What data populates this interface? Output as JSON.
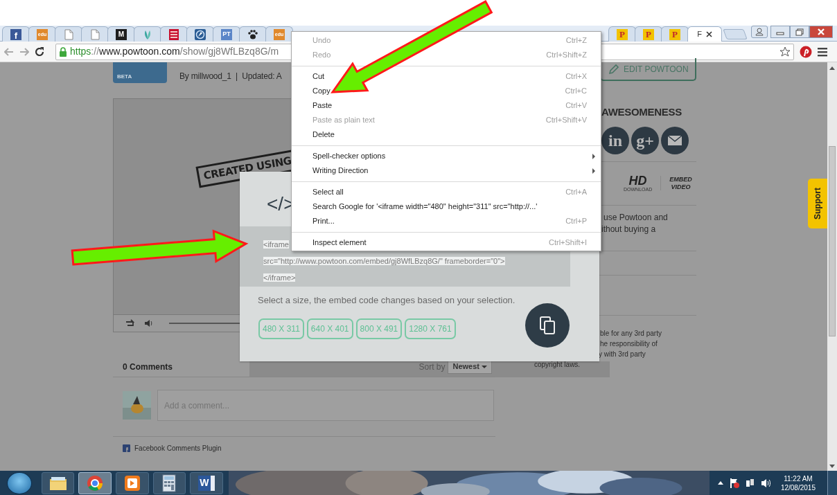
{
  "browser": {
    "tabs": [
      {
        "kind": "facebook",
        "icon_text": "f",
        "selected": false
      },
      {
        "kind": "edu",
        "icon_text": "edu",
        "selected": false
      },
      {
        "kind": "page",
        "selected": false
      },
      {
        "kind": "page",
        "selected": false
      },
      {
        "kind": "letter",
        "icon_text": "M",
        "selected": false
      },
      {
        "kind": "leaf",
        "selected": false
      },
      {
        "kind": "poster",
        "selected": false
      },
      {
        "kind": "compass",
        "selected": false
      },
      {
        "kind": "letter_blue",
        "icon_text": "PT",
        "selected": false
      },
      {
        "kind": "paw",
        "selected": false
      },
      {
        "kind": "edu",
        "icon_text": "edu",
        "selected": false
      }
    ],
    "more_tabs": [
      {
        "kind": "powtoon",
        "icon_text": "P",
        "selected": false
      },
      {
        "kind": "powtoon",
        "icon_text": "P",
        "selected": false
      },
      {
        "kind": "powtoon",
        "icon_text": "P",
        "selected": false
      },
      {
        "kind": "plain",
        "label": "F",
        "selected": true
      }
    ],
    "address": {
      "secure": true,
      "scheme": "https",
      "separator": "://",
      "host": "www.powtoon.com",
      "path": "/show/gj8WfLBzq8G/m"
    }
  },
  "page": {
    "logo_badge": "BETA",
    "byline": "By millwood_1  |  Updated: A",
    "video": {
      "stamp": "CREATED USING"
    },
    "comments": {
      "count": "0 Comments",
      "sort_label": "Sort by",
      "sort_value": "Newest",
      "placeholder": "Add a comment...",
      "plugin": "Facebook Comments Plugin"
    },
    "edit_button": "EDIT POWTOON",
    "share_heading": "AWESOMENESS",
    "share_buttons": [
      {
        "kind": "text",
        "label": "in"
      },
      {
        "kind": "text",
        "label": "g+"
      },
      {
        "kind": "mail"
      }
    ],
    "features": [
      {
        "title": "HD",
        "subtitle": "DOWNLOAD"
      },
      {
        "title": "EMBED VIDEO"
      }
    ],
    "promo_lines": [
      "use Powtoon and",
      "ithout buying a"
    ],
    "disclaimer_lines": [
      "ble for any 3rd party",
      "he responsibility of",
      "y with 3rd party",
      "copyright laws."
    ],
    "support_tab": "Support"
  },
  "embed_dialog": {
    "code_symbol": "</>",
    "code_lines": [
      "<iframe",
      "src=\"http://www.powtoon.com/embed/gj8WfLBzq8G/\" frameborder=\"0\">",
      "</iframe>"
    ],
    "hint": "Select a size, the embed code changes based on your selection.",
    "sizes": [
      "480 X 311",
      "640 X 401",
      "800 X 491",
      "1280 X 761"
    ]
  },
  "context_menu": [
    {
      "kind": "item",
      "label": "Undo",
      "shortcut": "Ctrl+Z",
      "disabled": true
    },
    {
      "kind": "item",
      "label": "Redo",
      "shortcut": "Ctrl+Shift+Z",
      "disabled": true
    },
    {
      "kind": "separator"
    },
    {
      "kind": "item",
      "label": "Cut",
      "shortcut": "Ctrl+X",
      "disabled": false
    },
    {
      "kind": "item",
      "label": "Copy",
      "shortcut": "Ctrl+C",
      "disabled": false
    },
    {
      "kind": "item",
      "label": "Paste",
      "shortcut": "Ctrl+V",
      "disabled": false
    },
    {
      "kind": "item",
      "label": "Paste as plain text",
      "shortcut": "Ctrl+Shift+V",
      "disabled": true
    },
    {
      "kind": "item",
      "label": "Delete",
      "disabled": false
    },
    {
      "kind": "separator"
    },
    {
      "kind": "item",
      "label": "Spell-checker options",
      "submenu": true,
      "disabled": false
    },
    {
      "kind": "item",
      "label": "Writing Direction",
      "submenu": true,
      "disabled": false
    },
    {
      "kind": "separator"
    },
    {
      "kind": "item",
      "label": "Select all",
      "shortcut": "Ctrl+A",
      "disabled": false
    },
    {
      "kind": "item",
      "label": "Search Google for '<iframe width=\"480\" height=\"311\" src=\"http://...'",
      "disabled": false
    },
    {
      "kind": "item",
      "label": "Print...",
      "shortcut": "Ctrl+P",
      "disabled": false
    },
    {
      "kind": "separator"
    },
    {
      "kind": "item",
      "label": "Inspect element",
      "shortcut": "Ctrl+Shift+I",
      "disabled": false
    }
  ],
  "taskbar": {
    "apps": [
      {
        "kind": "explorer",
        "selected": false
      },
      {
        "kind": "chrome",
        "selected": true
      },
      {
        "kind": "media",
        "selected": false
      },
      {
        "kind": "calculator",
        "selected": false
      },
      {
        "kind": "word",
        "icon_text": "W",
        "selected": false
      }
    ],
    "time": "11:22 AM",
    "date": "12/08/2015"
  }
}
